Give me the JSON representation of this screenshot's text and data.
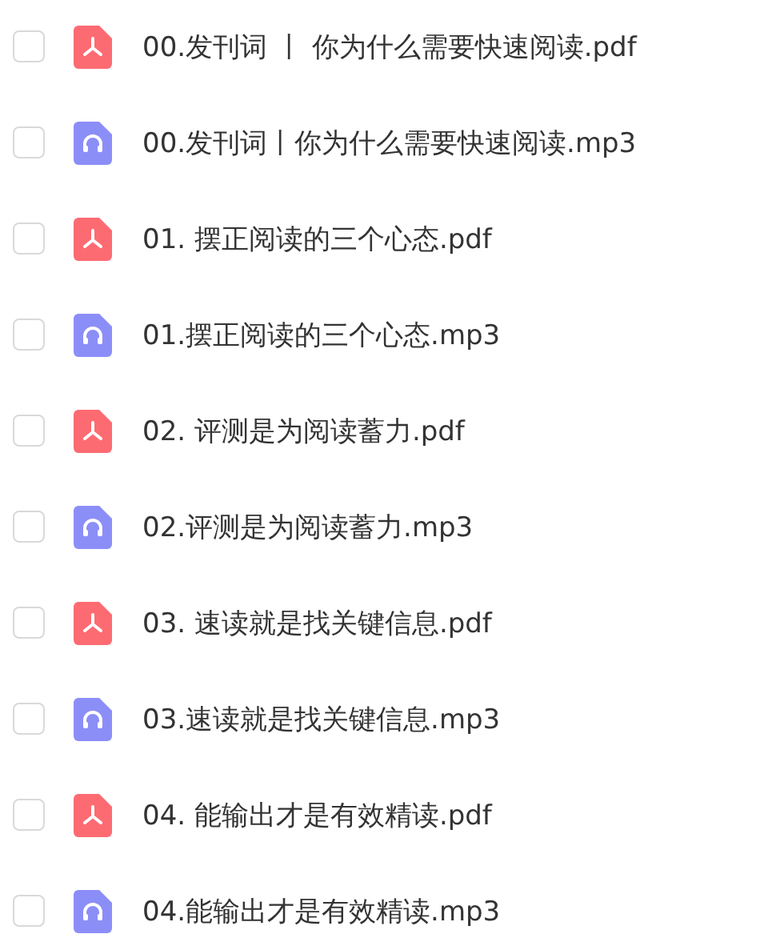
{
  "files": [
    {
      "name": "00.发刊词 丨 你为什么需要快速阅读.pdf",
      "kind": "pdf",
      "checked": false
    },
    {
      "name": "00.发刊词丨你为什么需要快速阅读.mp3",
      "kind": "audio",
      "checked": false
    },
    {
      "name": "01. 摆正阅读的三个心态.pdf",
      "kind": "pdf",
      "checked": false
    },
    {
      "name": "01.摆正阅读的三个心态.mp3",
      "kind": "audio",
      "checked": false
    },
    {
      "name": "02. 评测是为阅读蓄力.pdf",
      "kind": "pdf",
      "checked": false
    },
    {
      "name": "02.评测是为阅读蓄力.mp3",
      "kind": "audio",
      "checked": false
    },
    {
      "name": "03. 速读就是找关键信息.pdf",
      "kind": "pdf",
      "checked": false
    },
    {
      "name": "03.速读就是找关键信息.mp3",
      "kind": "audio",
      "checked": false
    },
    {
      "name": "04. 能输出才是有效精读.pdf",
      "kind": "pdf",
      "checked": false
    },
    {
      "name": "04.能输出才是有效精读.mp3",
      "kind": "audio",
      "checked": false
    }
  ]
}
